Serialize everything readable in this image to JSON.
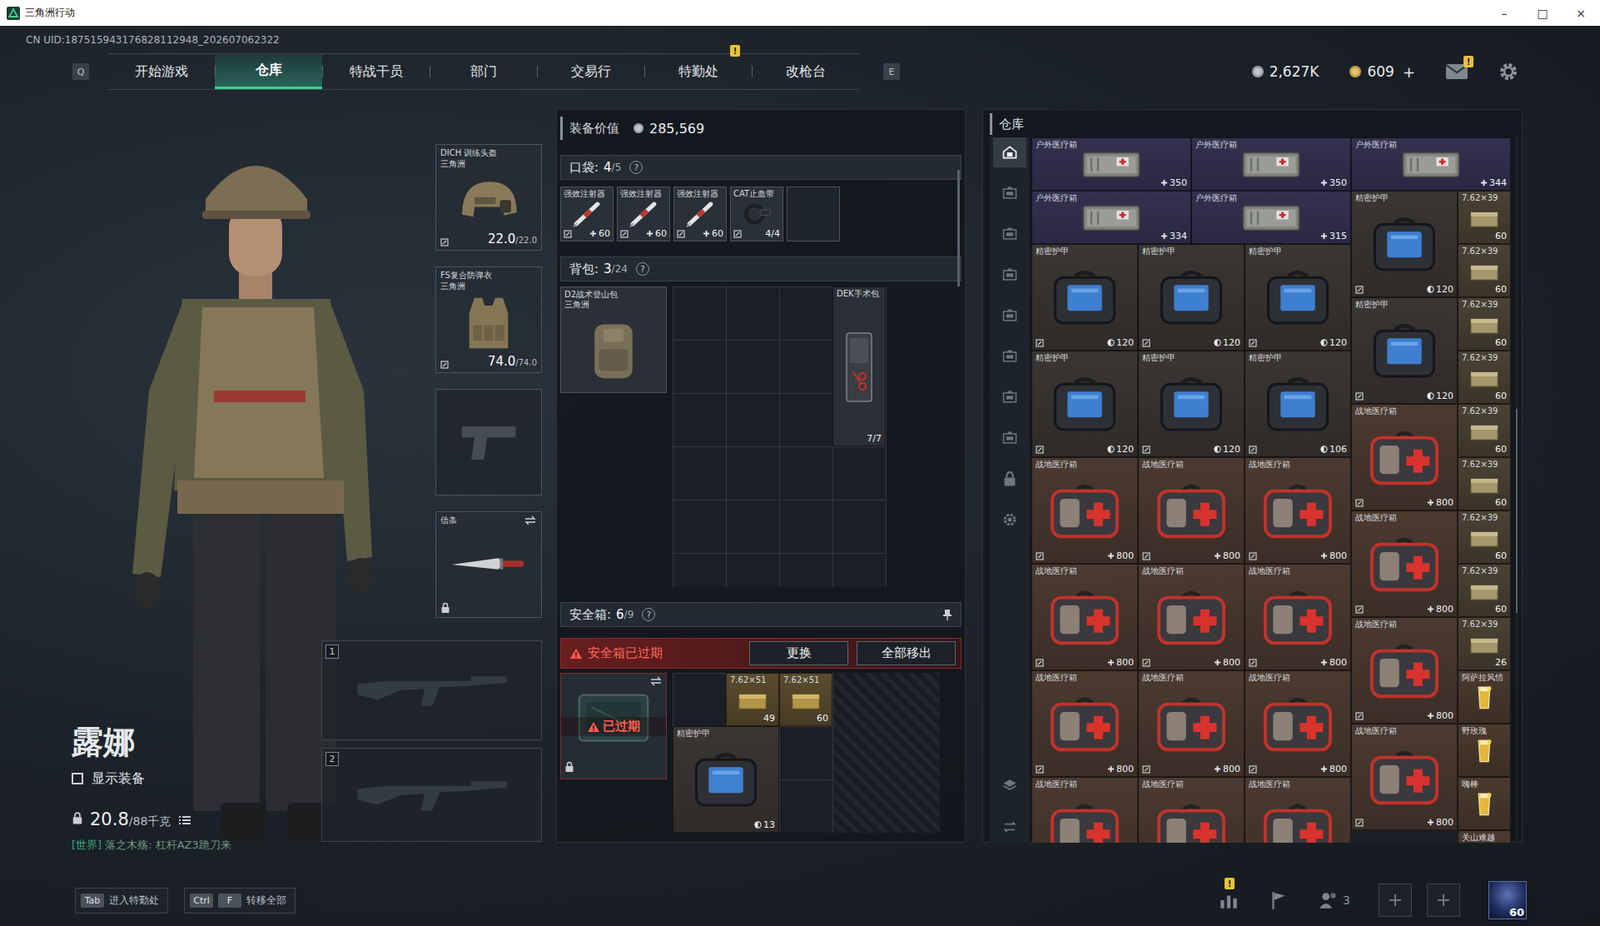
{
  "window": {
    "title": "三角洲行动",
    "controls": [
      "–",
      "□",
      "×"
    ]
  },
  "uid": "CN UID:187515943176828112948_202607062322",
  "alert_mark": "!",
  "nav": {
    "left_key": "Q",
    "right_key": "E",
    "tabs": [
      {
        "label": "开始游戏",
        "selected": false,
        "alert": false
      },
      {
        "label": "仓库",
        "selected": true,
        "alert": false
      },
      {
        "label": "特战干员",
        "selected": false,
        "alert": false
      },
      {
        "label": "部门",
        "selected": false,
        "alert": false
      },
      {
        "label": "交易行",
        "selected": false,
        "alert": false
      },
      {
        "label": "特勤处",
        "selected": false,
        "alert": true
      },
      {
        "label": "改枪台",
        "selected": false,
        "alert": false
      }
    ]
  },
  "currency": [
    {
      "kind": "silver",
      "amount": "2,627K",
      "add": ""
    },
    {
      "kind": "gold",
      "amount": "609",
      "add": "+"
    }
  ],
  "mail": {
    "alert": true
  },
  "operator": {
    "name": "露娜",
    "show_gear": {
      "label": "显示装备",
      "checked": false
    },
    "weight": "20.8",
    "weight_max": "/88千克",
    "chat_channel": "[世界]",
    "chat": "落之木殇: 杠杆AZ3跪刀来"
  },
  "equipment": {
    "helmet": {
      "name": "DICH 训练头盔",
      "brand": "三角洲",
      "durability": "22.0",
      "max": "/22.0"
    },
    "armor": {
      "name": "FS复合防弹衣",
      "brand": "三角洲",
      "durability": "74.0",
      "max": "/74.0"
    },
    "melee": {
      "name": "信条",
      "locked": true
    },
    "weapon_slots": [
      "1",
      "2"
    ]
  },
  "loadout": {
    "value_label": "装备价值",
    "value": "285,569",
    "pocket": {
      "label": "口袋:",
      "used": "4",
      "cap": "/5",
      "help": "?",
      "slots": 5,
      "items": [
        {
          "name": "强效注射器",
          "kind": "syringe",
          "count": "60"
        },
        {
          "name": "强效注射器",
          "kind": "syringe",
          "count": "60"
        },
        {
          "name": "强效注射器",
          "kind": "syringe",
          "count": "60"
        },
        {
          "name": "CAT止血带",
          "kind": "tourniquet",
          "count": "4/4"
        }
      ]
    },
    "backpack": {
      "label": "背包:",
      "used": "3",
      "cap": "/24",
      "help": "?",
      "bag": {
        "name": "D2战术登山包",
        "brand": "三角洲"
      },
      "items": [
        {
          "name": "DEK手术包",
          "kind": "surgical",
          "count": "7/7"
        }
      ]
    },
    "safe": {
      "label": "安全箱:",
      "used": "6",
      "cap": "/9",
      "help": "?",
      "expired": true,
      "notice": "安全箱已过期",
      "badge": "已过期",
      "buttons": [
        "更换",
        "全部移出"
      ],
      "items": [
        {
          "name": "7.62×51",
          "kind": "ammo51",
          "count": "49"
        },
        {
          "name": "7.62×51",
          "kind": "ammo51",
          "count": "60"
        },
        {
          "name": "精密护甲",
          "kind": "armor",
          "count": "13"
        }
      ]
    }
  },
  "warehouse": {
    "title": "仓库",
    "side_tabs": [
      {
        "kind": "home",
        "selected": true
      },
      {
        "kind": "case",
        "selected": false
      },
      {
        "kind": "case",
        "selected": false
      },
      {
        "kind": "case",
        "selected": false
      },
      {
        "kind": "case",
        "selected": false
      },
      {
        "kind": "case",
        "selected": false
      },
      {
        "kind": "case",
        "selected": false
      },
      {
        "kind": "case",
        "selected": false
      },
      {
        "kind": "lock",
        "selected": false
      },
      {
        "kind": "gear",
        "selected": false
      }
    ],
    "items": [
      {
        "name": "户外医疗箱",
        "kind": "outdoor",
        "count": "350",
        "bound": false
      },
      {
        "name": "户外医疗箱",
        "kind": "outdoor",
        "count": "350",
        "bound": false
      },
      {
        "name": "户外医疗箱",
        "kind": "outdoor",
        "count": "344",
        "bound": false
      },
      {
        "name": "户外医疗箱",
        "kind": "outdoor",
        "count": "334",
        "bound": false
      },
      {
        "name": "户外医疗箱",
        "kind": "outdoor",
        "count": "315",
        "bound": false
      },
      {
        "name": "精密护甲",
        "kind": "armor",
        "count": "120",
        "bound": true
      },
      {
        "name": "7.62×39",
        "kind": "ammo",
        "count": "60",
        "bound": false
      },
      {
        "name": "精密护甲",
        "kind": "armor",
        "count": "120",
        "bound": true
      },
      {
        "name": "精密护甲",
        "kind": "armor",
        "count": "120",
        "bound": true
      },
      {
        "name": "精密护甲",
        "kind": "armor",
        "count": "120",
        "bound": true
      },
      {
        "name": "7.62×39",
        "kind": "ammo",
        "count": "60",
        "bound": false
      },
      {
        "name": "精密护甲",
        "kind": "armor",
        "count": "120",
        "bound": true
      },
      {
        "name": "7.62×39",
        "kind": "ammo",
        "count": "60",
        "bound": false
      },
      {
        "name": "精密护甲",
        "kind": "armor",
        "count": "120",
        "bound": true
      },
      {
        "name": "精密护甲",
        "kind": "armor",
        "count": "120",
        "bound": true
      },
      {
        "name": "精密护甲",
        "kind": "armor",
        "count": "106",
        "bound": true
      },
      {
        "name": "7.62×39",
        "kind": "ammo",
        "count": "60",
        "bound": false
      },
      {
        "name": "战地医疗箱",
        "kind": "medkit",
        "count": "800",
        "bound": true
      },
      {
        "name": "7.62×39",
        "kind": "ammo",
        "count": "60",
        "bound": false
      },
      {
        "name": "战地医疗箱",
        "kind": "medkit",
        "count": "800",
        "bound": true
      },
      {
        "name": "战地医疗箱",
        "kind": "medkit",
        "count": "800",
        "bound": true
      },
      {
        "name": "战地医疗箱",
        "kind": "medkit",
        "count": "800",
        "bound": true
      },
      {
        "name": "7.62×39",
        "kind": "ammo",
        "count": "60",
        "bound": false
      },
      {
        "name": "战地医疗箱",
        "kind": "medkit",
        "count": "800",
        "bound": true
      },
      {
        "name": "7.62×39",
        "kind": "ammo",
        "count": "60",
        "bound": false
      },
      {
        "name": "战地医疗箱",
        "kind": "medkit",
        "count": "800",
        "bound": true
      },
      {
        "name": "战地医疗箱",
        "kind": "medkit",
        "count": "800",
        "bound": true
      },
      {
        "name": "战地医疗箱",
        "kind": "medkit",
        "count": "800",
        "bound": true
      },
      {
        "name": "7.62×39",
        "kind": "ammo",
        "count": "60",
        "bound": false
      },
      {
        "name": "战地医疗箱",
        "kind": "medkit",
        "count": "800",
        "bound": true
      },
      {
        "name": "7.62×39",
        "kind": "ammo",
        "count": "26",
        "bound": false
      },
      {
        "name": "战地医疗箱",
        "kind": "medkit",
        "count": "800",
        "bound": true
      },
      {
        "name": "战地医疗箱",
        "kind": "medkit",
        "count": "800",
        "bound": true
      },
      {
        "name": "战地医疗箱",
        "kind": "medkit",
        "count": "800",
        "bound": true
      },
      {
        "name": "阿萨拉风情",
        "kind": "drink",
        "count": "",
        "bound": false
      },
      {
        "name": "战地医疗箱",
        "kind": "medkit",
        "count": "800",
        "bound": true
      },
      {
        "name": "野玫瑰",
        "kind": "drink",
        "count": "",
        "bound": false
      },
      {
        "name": "战地医疗箱",
        "kind": "medkit",
        "count": "",
        "bound": false
      },
      {
        "name": "战地医疗箱",
        "kind": "medkit",
        "count": "",
        "bound": false
      },
      {
        "name": "战地医疗箱",
        "kind": "medkit",
        "count": "",
        "bound": false
      },
      {
        "name": "嗨棒",
        "kind": "drink",
        "count": "",
        "bound": false
      },
      {
        "name": "关山难越",
        "kind": "drink",
        "count": "",
        "bound": false
      }
    ]
  },
  "bottom": {
    "hints": [
      {
        "keys": [
          "Tab"
        ],
        "label": "进入特勤处"
      },
      {
        "keys": [
          "Ctrl",
          "F"
        ],
        "label": "转移全部"
      }
    ],
    "squad": "3",
    "level": "60",
    "stats_alert": true
  }
}
